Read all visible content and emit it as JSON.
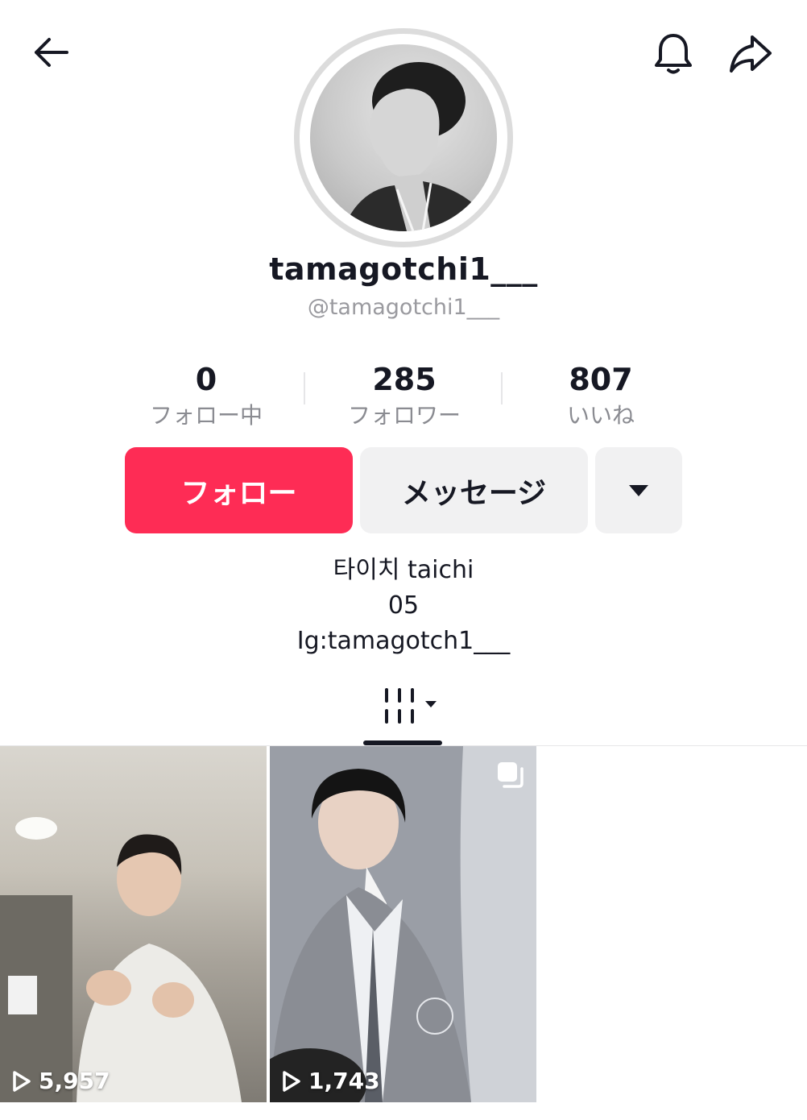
{
  "profile": {
    "display_name": "tamagotchi1___",
    "handle": "@tamagotchi1___"
  },
  "stats": {
    "following": {
      "value": "0",
      "label": "フォロー中"
    },
    "followers": {
      "value": "285",
      "label": "フォロワー"
    },
    "likes": {
      "value": "807",
      "label": "いいね"
    }
  },
  "actions": {
    "follow_label": "フォロー",
    "message_label": "メッセージ"
  },
  "bio": {
    "line1": "타이치 taichi",
    "line2": "05",
    "line3": "Ig:tamagotch1___"
  },
  "videos": [
    {
      "views": "5,957",
      "multi_image": false
    },
    {
      "views": "1,743",
      "multi_image": true
    }
  ],
  "colors": {
    "follow_button": "#fe2c55",
    "secondary_button": "#f1f1f2",
    "text_primary": "#161823",
    "text_secondary": "#8a8b91"
  },
  "icons": [
    "back-arrow-icon",
    "bell-icon",
    "share-icon",
    "dropdown-triangle-icon",
    "videos-grid-icon",
    "play-icon",
    "multi-image-icon"
  ]
}
